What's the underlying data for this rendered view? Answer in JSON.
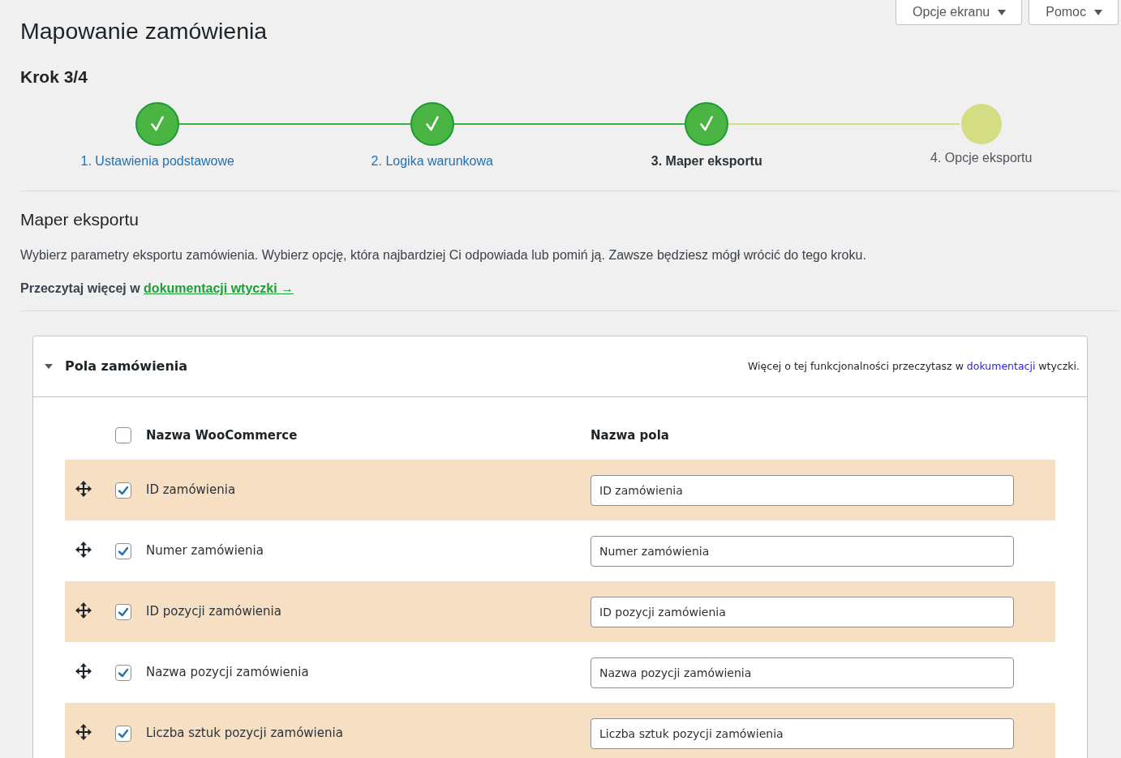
{
  "header_buttons": [
    {
      "label": "Opcje ekranu"
    },
    {
      "label": "Pomoc"
    }
  ],
  "page_title": "Mapowanie zamówienia",
  "step_counter": "Krok 3/4",
  "steps": [
    {
      "label": "1. Ustawienia podstawowe",
      "completed": true,
      "selected": false
    },
    {
      "label": "2. Logika warunkowa",
      "completed": true,
      "selected": false
    },
    {
      "label": "3. Maper eksportu",
      "completed": true,
      "selected": true
    },
    {
      "label": "4. Opcje eksportu",
      "completed": false,
      "selected": false
    }
  ],
  "section": {
    "title": "Maper eksportu",
    "description": "Wybierz parametry eksportu zamówienia. Wybierz opcję, która najbardziej Ci odpowiada lub pomiń ją. Zawsze będziesz mógł wrócić do tego kroku.",
    "read_more": {
      "text": "Przeczytaj więcej w",
      "link": "dokumentacji wtyczki →"
    }
  },
  "panel": {
    "title": "Pola zamówienia",
    "expanded": true,
    "note": {
      "before": "Więcej o tej funkcjonalności przeczytasz w",
      "link": "dokumentacji",
      "after": "wtyczki."
    },
    "select_all": {
      "checked": false
    },
    "columns": [
      "Nazwa WooCommerce",
      "Nazwa pola"
    ],
    "rows": [
      {
        "name": "ID zamówienia",
        "checked": true,
        "value": "ID zamówienia"
      },
      {
        "name": "Numer zamówienia",
        "checked": true,
        "value": "Numer zamówienia"
      },
      {
        "name": "ID pozycji zamówienia",
        "checked": true,
        "value": "ID pozycji zamówienia"
      },
      {
        "name": "Nazwa pozycji zamówienia",
        "checked": true,
        "value": "Nazwa pozycji zamówienia"
      },
      {
        "name": "Liczba sztuk pozycji zamówienia",
        "checked": true,
        "value": "Liczba sztuk pozycji zamówienia"
      }
    ]
  }
}
